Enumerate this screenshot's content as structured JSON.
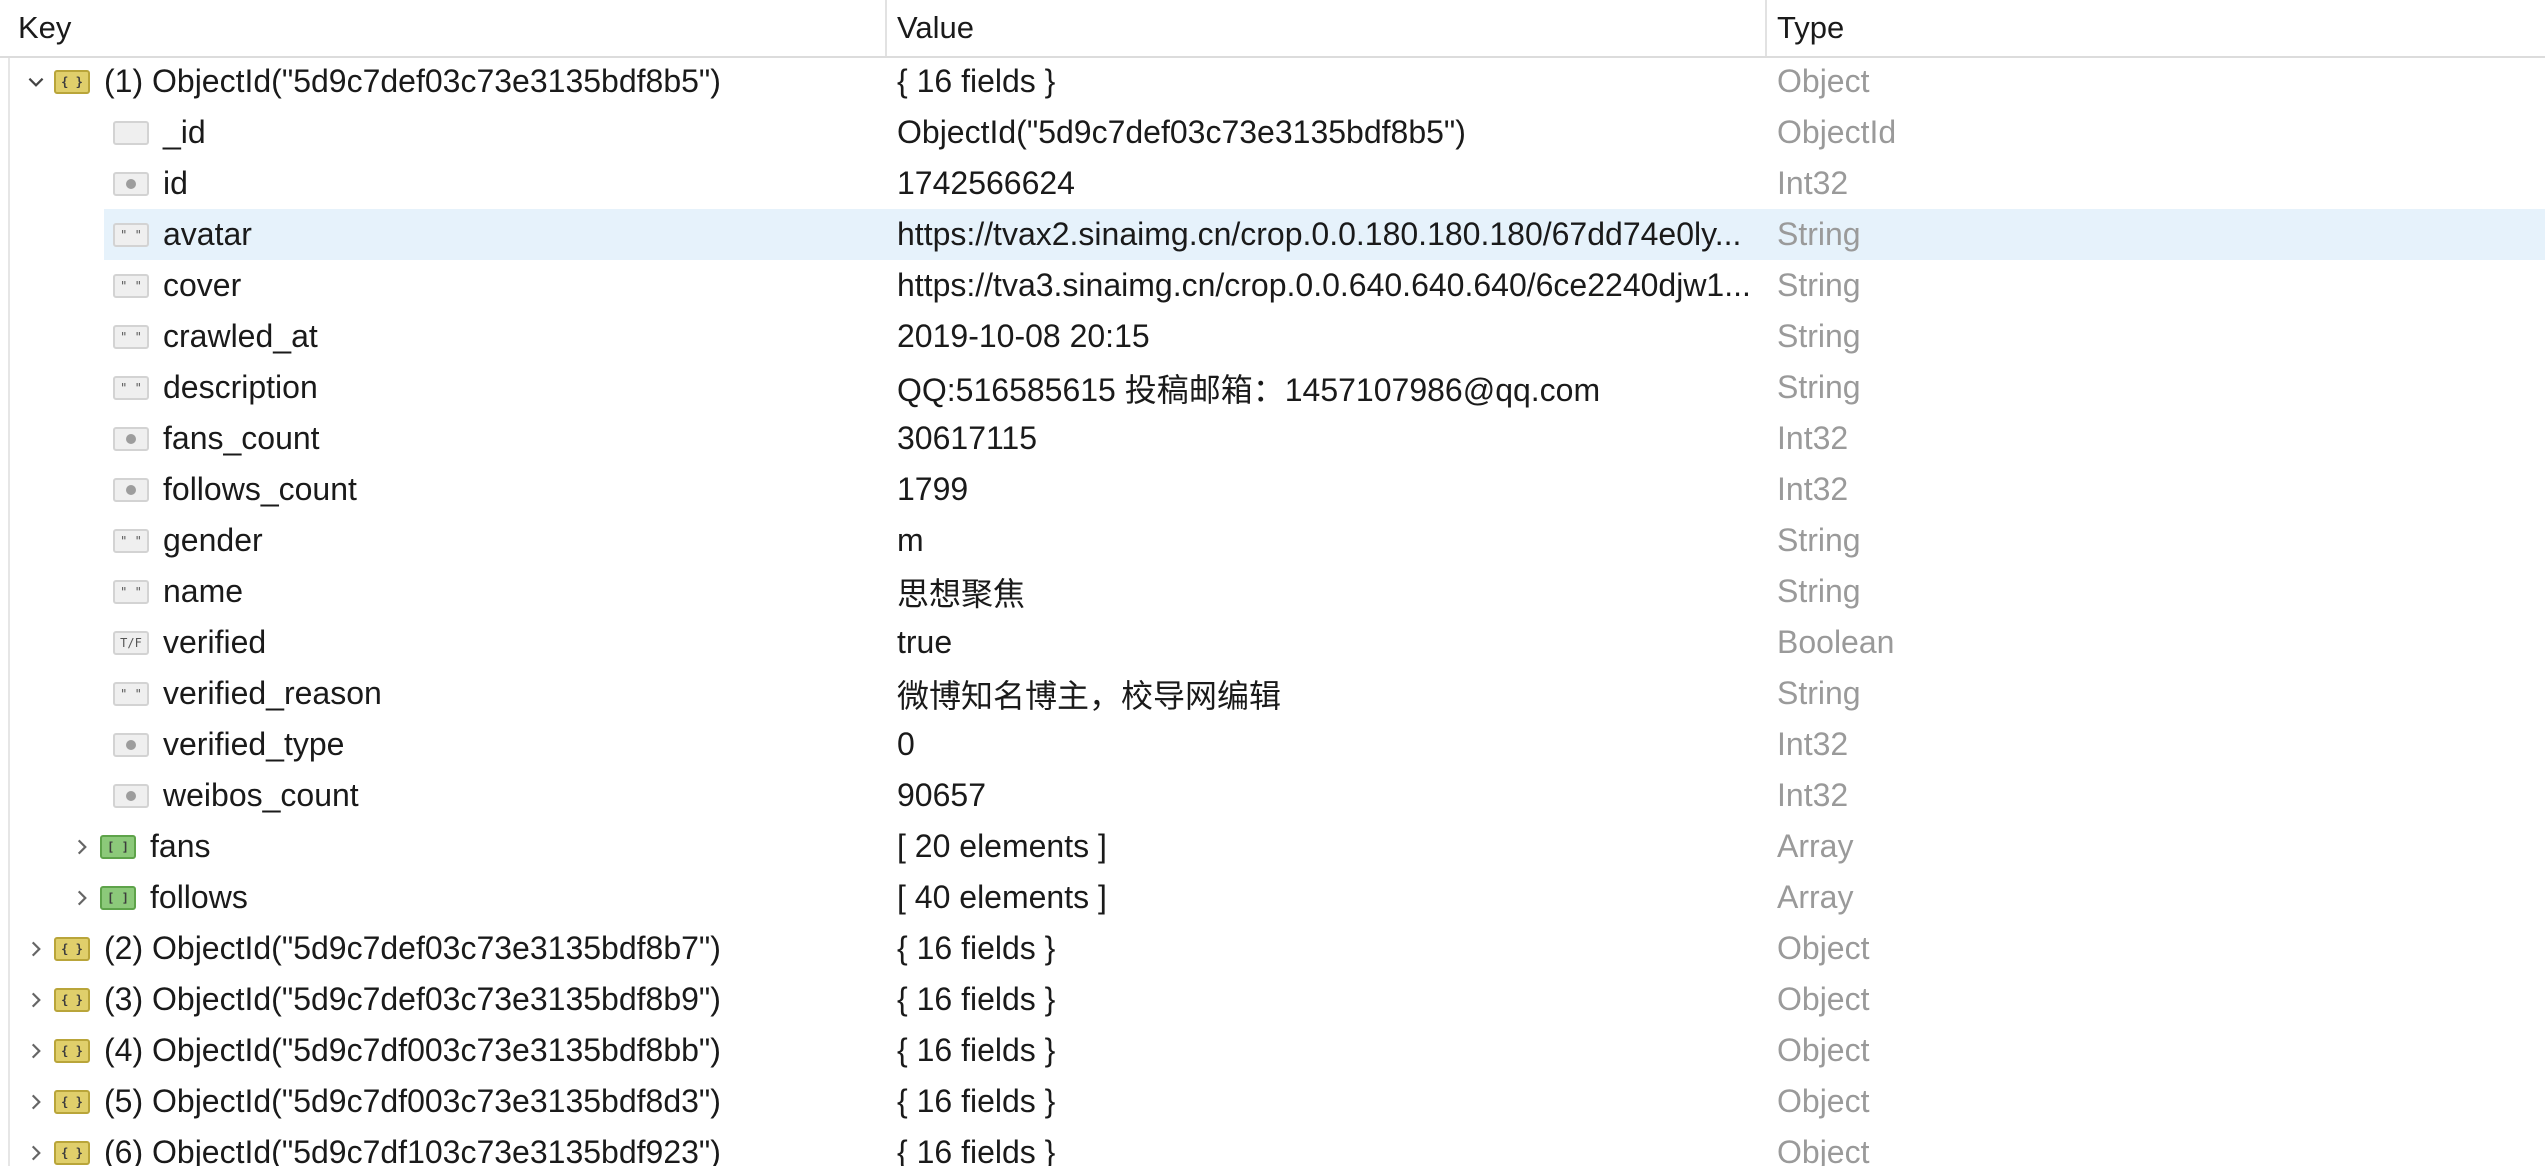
{
  "columns": {
    "key": "Key",
    "value": "Value",
    "type": "Type"
  },
  "rows": [
    {
      "key": "(1) ObjectId(\"5d9c7def03c73e3135bdf8b5\")",
      "value": "{ 16 fields }",
      "type": "Object",
      "icon": "object-icon"
    },
    {
      "key": "_id",
      "value": "ObjectId(\"5d9c7def03c73e3135bdf8b5\")",
      "type": "ObjectId",
      "icon": "objectid-icon"
    },
    {
      "key": "id",
      "value": "1742566624",
      "type": "Int32",
      "icon": "int-icon"
    },
    {
      "key": "avatar",
      "value": "https://tvax2.sinaimg.cn/crop.0.0.180.180.180/67dd74e0ly...",
      "type": "String",
      "icon": "string-icon"
    },
    {
      "key": "cover",
      "value": "https://tva3.sinaimg.cn/crop.0.0.640.640.640/6ce2240djw1...",
      "type": "String",
      "icon": "string-icon"
    },
    {
      "key": "crawled_at",
      "value": "2019-10-08 20:15",
      "type": "String",
      "icon": "string-icon"
    },
    {
      "key": "description",
      "value": "QQ:516585615 投稿邮箱：1457107986@qq.com",
      "type": "String",
      "icon": "string-icon"
    },
    {
      "key": "fans_count",
      "value": "30617115",
      "type": "Int32",
      "icon": "int-icon"
    },
    {
      "key": "follows_count",
      "value": "1799",
      "type": "Int32",
      "icon": "int-icon"
    },
    {
      "key": "gender",
      "value": "m",
      "type": "String",
      "icon": "string-icon"
    },
    {
      "key": "name",
      "value": "思想聚焦",
      "type": "String",
      "icon": "string-icon"
    },
    {
      "key": "verified",
      "value": "true",
      "type": "Boolean",
      "icon": "boolean-icon"
    },
    {
      "key": "verified_reason",
      "value": "微博知名博主，校导网编辑",
      "type": "String",
      "icon": "string-icon"
    },
    {
      "key": "verified_type",
      "value": "0",
      "type": "Int32",
      "icon": "int-icon"
    },
    {
      "key": "weibos_count",
      "value": "90657",
      "type": "Int32",
      "icon": "int-icon"
    },
    {
      "key": "fans",
      "value": "[ 20 elements ]",
      "type": "Array",
      "icon": "array-icon"
    },
    {
      "key": "follows",
      "value": "[ 40 elements ]",
      "type": "Array",
      "icon": "array-icon"
    },
    {
      "key": "(2) ObjectId(\"5d9c7def03c73e3135bdf8b7\")",
      "value": "{ 16 fields }",
      "type": "Object",
      "icon": "object-icon"
    },
    {
      "key": "(3) ObjectId(\"5d9c7def03c73e3135bdf8b9\")",
      "value": "{ 16 fields }",
      "type": "Object",
      "icon": "object-icon"
    },
    {
      "key": "(4) ObjectId(\"5d9c7df003c73e3135bdf8bb\")",
      "value": "{ 16 fields }",
      "type": "Object",
      "icon": "object-icon"
    },
    {
      "key": "(5) ObjectId(\"5d9c7df003c73e3135bdf8d3\")",
      "value": "{ 16 fields }",
      "type": "Object",
      "icon": "object-icon"
    },
    {
      "key": "(6) ObjectId(\"5d9c7df103c73e3135bdf923\")",
      "value": "{ 16 fields }",
      "type": "Object",
      "icon": "object-icon"
    }
  ],
  "icon_glyphs": {
    "string": "\" \"",
    "boolean": "T/F",
    "object": "{ }",
    "array": "[ ]"
  },
  "colors": {
    "selected_row": "#e6f2fb",
    "type_text": "#9a9a9a",
    "object_icon": "#e0cf6b",
    "array_icon": "#8cc97a"
  }
}
